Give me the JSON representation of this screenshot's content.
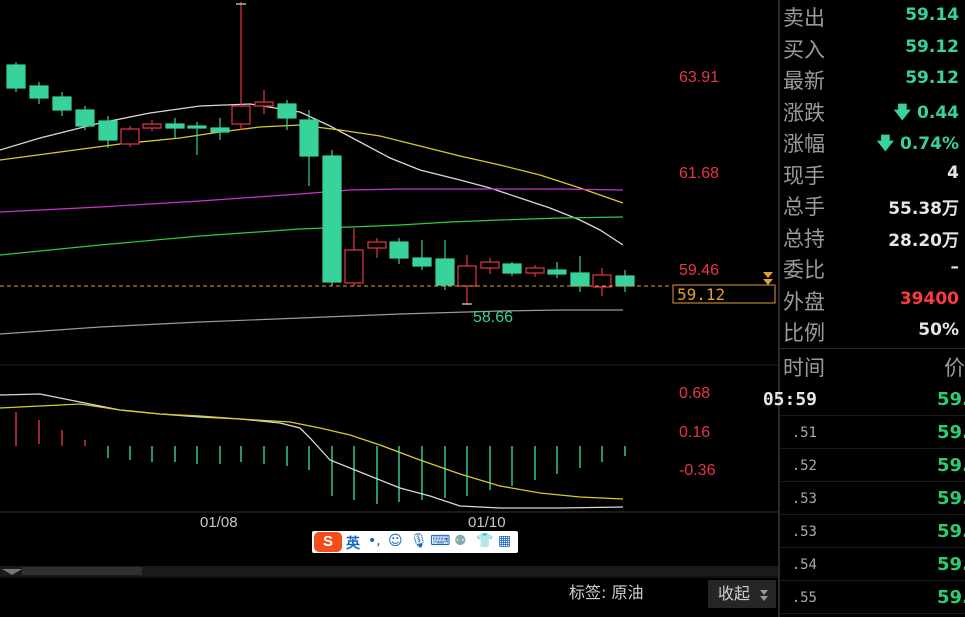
{
  "colors": {
    "up": "#e8344a",
    "down": "#37d39a",
    "ma_white": "#d8d8d8",
    "ma_yellow": "#d6cc28",
    "ma_magenta": "#cc33cc",
    "ma_green": "#2ecc40",
    "ma_gray": "#9a9a9a",
    "current_line": "#e0a030"
  },
  "chart": {
    "price_labels": [
      "63.91",
      "61.68",
      "59.46"
    ],
    "current_price_tag": "59.12",
    "low_label": "58.66",
    "macd_labels": [
      "0.68",
      "0.16",
      "-0.36"
    ],
    "date_labels": [
      "01/08",
      "01/10"
    ],
    "tag_label": "标签: 原油",
    "collapse_button": "收起"
  },
  "quote": [
    {
      "label": "卖出",
      "value": "59.14",
      "color": "#37d39a"
    },
    {
      "label": "买入",
      "value": "59.12",
      "color": "#37d39a"
    },
    {
      "label": "最新",
      "value": "59.12",
      "color": "#37d39a"
    },
    {
      "label": "涨跌",
      "value": "🡇 0.44",
      "color": "#37d39a"
    },
    {
      "label": "涨幅",
      "value": "🡇 0.74%",
      "color": "#37d39a"
    },
    {
      "label": "现手",
      "value": "4",
      "color": "#e6e6e6"
    },
    {
      "label": "总手",
      "value": "55.38万",
      "color": "#e6e6e6"
    },
    {
      "label": "总持",
      "value": "28.20万",
      "color": "#e6e6e6"
    },
    {
      "label": "委比",
      "value": "–",
      "color": "#e6e6e6"
    },
    {
      "label": "外盘",
      "value": "39400",
      "color": "#ff3b3b"
    },
    {
      "label": "比例",
      "value": "50%",
      "color": "#e6e6e6"
    }
  ],
  "ticks_header": {
    "time": "时间",
    "price": "价"
  },
  "ticks": [
    {
      "time": "05:59",
      "price": "59."
    },
    {
      "time": ".51",
      "price": "59."
    },
    {
      "time": ".52",
      "price": "59."
    },
    {
      "time": ".53",
      "price": "59."
    },
    {
      "time": ".53",
      "price": "59."
    },
    {
      "time": ".54",
      "price": "59."
    },
    {
      "time": ".55",
      "price": "59."
    }
  ],
  "ime": {
    "lang": "英"
  }
}
